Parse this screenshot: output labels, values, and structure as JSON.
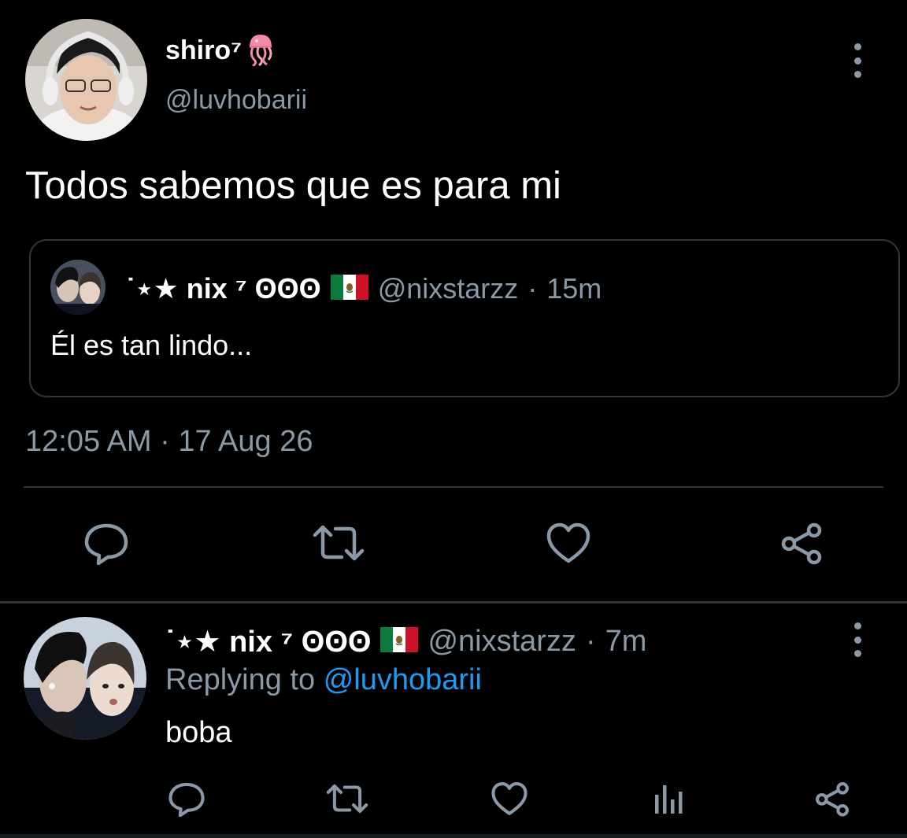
{
  "main_tweet": {
    "display_name": "shiro⁷",
    "name_emoji_icon": "jellyfish-icon",
    "handle": "@luvhobarii",
    "text": "Todos sabemos que es para mi",
    "timestamp": "12:05 AM · 17 Aug 26",
    "quoted_tweet": {
      "display_name": "˙⋆★ nix ⁷ ʘʘʘ",
      "flag_icon": "mexico-flag-icon",
      "handle": "@nixstarzz",
      "separator": "·",
      "time": "15m",
      "text": "Él es tan lindo..."
    },
    "actions": [
      "reply-icon",
      "retweet-icon",
      "like-icon",
      "share-icon"
    ]
  },
  "reply_tweet": {
    "display_name": "˙⋆★ nix ⁷ ʘʘʘ",
    "flag_icon": "mexico-flag-icon",
    "handle": "@nixstarzz",
    "separator": "·",
    "time": "7m",
    "replying_prefix": "Replying to",
    "replying_to": "@luvhobarii",
    "text": "boba",
    "actions": [
      "reply-icon",
      "retweet-icon",
      "like-icon",
      "analytics-icon",
      "share-icon"
    ]
  },
  "colors": {
    "background": "#000000",
    "primary_text": "#ffffff",
    "secondary_text": "#8b98a5",
    "link": "#1d9bf0",
    "border": "#333639"
  }
}
